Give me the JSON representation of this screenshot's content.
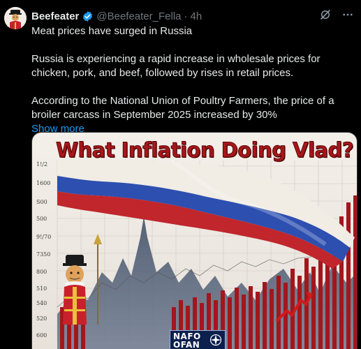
{
  "tweet": {
    "display_name": "Beefeater",
    "handle": "@Beefeater_Fella",
    "separator": "·",
    "time": "4h",
    "paragraphs": [
      "Meat prices have surged in Russia",
      "Russia is experiencing a rapid increase in wholesale prices for chicken, pork, and beef, followed by rises in retail prices.",
      "According to the National Union of Poultry Farmers, the price of a broiler carcass in September 2025 increased by 30%"
    ],
    "show_more": "Show more"
  },
  "media": {
    "title": "What Inflation Doing Vlad?",
    "y_ticks": [
      "1!/2",
      "1600",
      "S00",
      "500",
      "9!/70",
      "7350",
      "800",
      "510",
      "540",
      "520",
      "600"
    ],
    "badge_text": "NAFO OFAN",
    "colors": {
      "flag_white": "#f1ece4",
      "flag_blue": "#2d4fb0",
      "flag_red": "#c0262c",
      "bars": "#a3161c",
      "title": "#a8161b"
    }
  },
  "icons": [
    "avatar",
    "verified-icon",
    "grok-icon",
    "more-icon",
    "nato-star-icon"
  ]
}
